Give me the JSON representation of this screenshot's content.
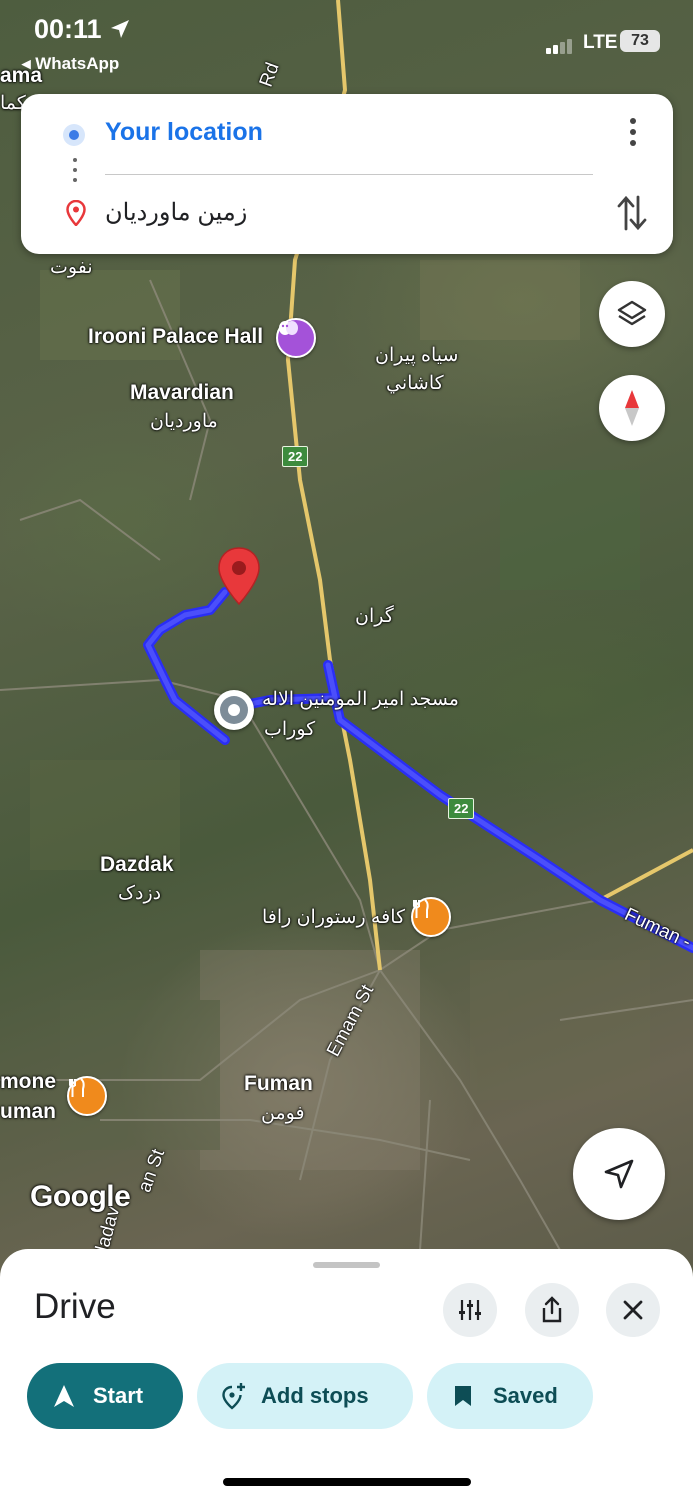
{
  "status_bar": {
    "time": "00:11",
    "back_app": "◂ WhatsApp",
    "network": "LTE",
    "battery": "73"
  },
  "directions": {
    "origin": "Your location",
    "destination": "زمین ماوردیان"
  },
  "map": {
    "labels": {
      "ama": "ama",
      "kama": "کما",
      "naft": "نفوت",
      "rd": "Rd",
      "irooni": "Irooni Palace Hall",
      "mavardian_en": "Mavardian",
      "mavardian_fa": "ماوردیان",
      "siah_piran": "سیاه پیران",
      "kashani": "کاشاني",
      "geran": "گران",
      "masjid": "مسجد امیر المومنین الاله",
      "kurab": "کوراب",
      "dazdak_en": "Dazdak",
      "dazdak_fa": "دزدک",
      "cafe": "کافه رستوران رافا",
      "fuman_en": "Fuman",
      "fuman_fa": "فومن",
      "emam_st": "Emam St",
      "fuman_road": "Fuman -",
      "mone": "mone",
      "uman": "uman",
      "ladav": "ladav",
      "an_st": "an St",
      "google": "Google"
    },
    "road_shield": "22",
    "route_color": "#2a2ef5"
  },
  "bottom_sheet": {
    "mode": "Drive",
    "start_label": "Start",
    "add_stops_label": "Add stops",
    "saved_label": "Saved"
  },
  "colors": {
    "accent_blue": "#1a73e8",
    "start_chip": "#13707a",
    "secondary_chip": "#d4f2f7"
  }
}
